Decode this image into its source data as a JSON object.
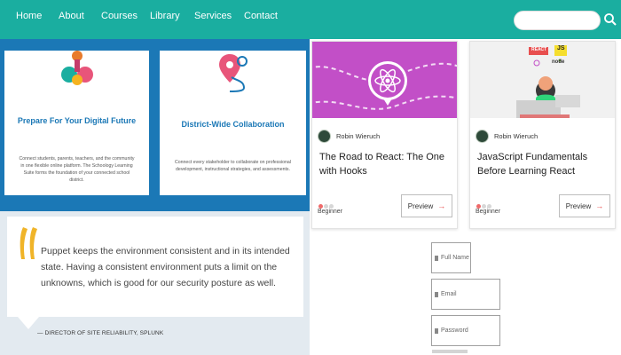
{
  "nav": {
    "items": [
      "Home",
      "About",
      "Courses",
      "Library",
      "Services",
      "Contact"
    ],
    "search_placeholder": ""
  },
  "features": [
    {
      "title": "Prepare For Your Digital Future",
      "body": "Connect students, parents, teachers, and the community in one flexible online platform. The Schoology Learning Suite forms the foundation of your connected school district."
    },
    {
      "title": "District-Wide Collaboration",
      "body": "Connect every stakeholder to collaborate on professional development, instructional strategies, and assessments."
    }
  ],
  "testimonial": {
    "quote": "Puppet keeps the environment consistent and in its intended state. Having a consistent environment puts a limit on the unknowns, which is good for our security posture as well.",
    "author": "— DIRECTOR OF SITE RELIABILITY, SPLUNK"
  },
  "courses": [
    {
      "author": "Robin Wieruch",
      "title": "The Road to React: The One with Hooks",
      "level": "Beginner",
      "preview_label": "Preview",
      "arrow": "→",
      "level_dots": 1
    },
    {
      "author": "Robin Wieruch",
      "title": "JavaScript Fundamentals Before Learning React",
      "level": "Beginner",
      "preview_label": "Preview",
      "arrow": "→",
      "level_dots": 1,
      "thumb_badges": [
        "REACT",
        "JS",
        "node"
      ]
    }
  ],
  "form": {
    "fields": [
      "Full Name",
      "Email",
      "Password"
    ]
  },
  "colors": {
    "nav_bg": "#1aaea0",
    "feature_bg": "#1b78b6",
    "quote_accent": "#f0b429",
    "react_thumb": "#c24fc7",
    "level_dot": "#ef6a6a"
  }
}
